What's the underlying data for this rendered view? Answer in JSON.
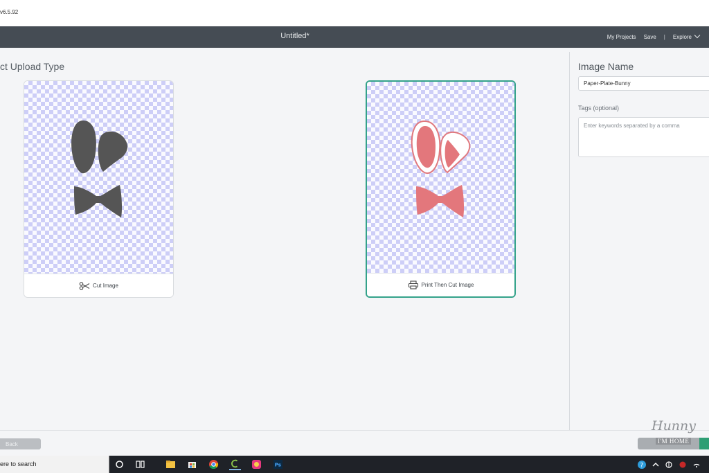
{
  "app": {
    "version_text": "v6.5.92",
    "document_title": "Untitled*"
  },
  "header_nav": {
    "my_projects": "My Projects",
    "save": "Save",
    "separator": "|",
    "explore": "Explore"
  },
  "main": {
    "section_title": "ct Upload Type",
    "cards": [
      {
        "label": "Cut Image",
        "icon": "scissors-icon",
        "selected": false
      },
      {
        "label": "Print Then Cut Image",
        "icon": "printer-icon",
        "selected": true
      }
    ]
  },
  "sidebar": {
    "image_name_heading": "Image Name",
    "image_name_value": "Paper-Plate-Bunny",
    "tags_label": "Tags (optional)",
    "tags_placeholder": "Enter keywords separated by a comma"
  },
  "footer": {
    "back_label": "Back"
  },
  "watermark": {
    "script": "Hunny",
    "sub": "I'M HOME"
  },
  "taskbar": {
    "search_text": "ere to search"
  },
  "colors": {
    "header_bg": "#454c54",
    "selected_border": "#33a28a",
    "cut_fill": "#555555",
    "print_fill": "#e3777c",
    "upload_green": "#2e9e74"
  }
}
